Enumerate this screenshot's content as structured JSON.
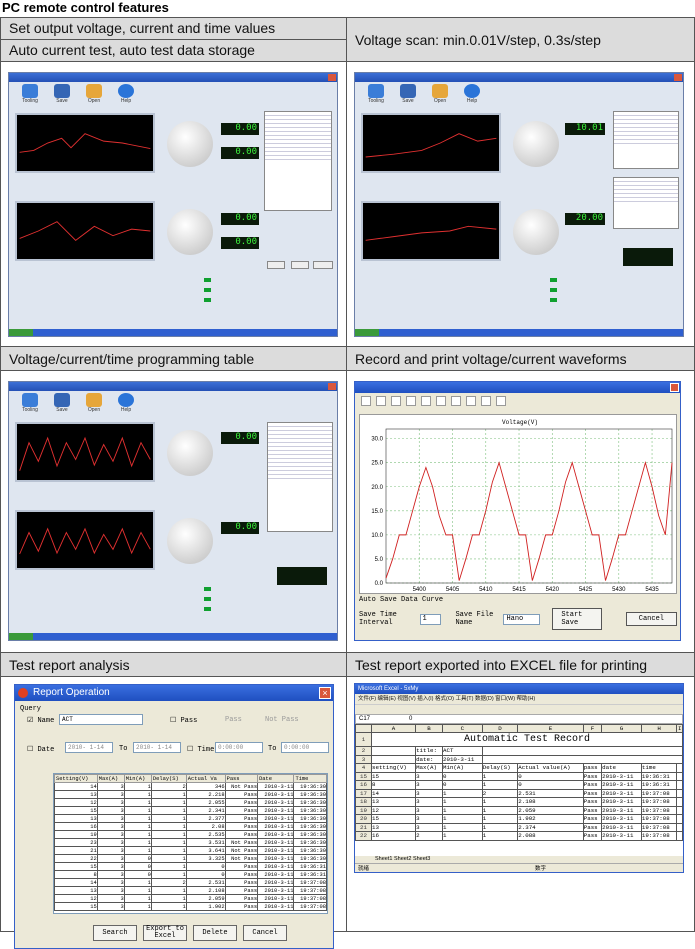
{
  "page_title": "PC remote control features",
  "cells": {
    "c1_line1": "Set output voltage, current and time values",
    "c1_line2": "Auto current test, auto test data storage",
    "c2": "Voltage scan: min.0.01V/step, 0.3s/step",
    "c3": "Voltage/current/time programming table",
    "c4": "Record and print voltage/current waveforms",
    "c5": "Test report analysis",
    "c6": "Test report exported into EXCEL file for printing"
  },
  "app_toolbar": [
    "Tooling",
    "Save",
    "Open",
    "Help"
  ],
  "lcd_values": {
    "s1_v": "0.00",
    "s1_i": "0.00",
    "s2_v": "10.01",
    "s2_i": "20.00",
    "s3_v": "0.00",
    "s3_i": "0.00"
  },
  "waveform": {
    "plot_title": "Voltage(V)",
    "auto_save_label": "Auto Save Data Curve",
    "interval_label": "Save Time Interval",
    "interval_value": "1",
    "file_name_label": "Save File Name",
    "file_name_value": "Hano",
    "start_button": "Start Save",
    "cancel_button": "Cancel"
  },
  "report": {
    "window_title": "Report Operation",
    "query_label": "Query",
    "name_label": "Name",
    "name_value": "ACT",
    "pass_label": "Pass",
    "radio_pass": "Pass",
    "radio_notpass": "Not Pass",
    "date_label": "Date",
    "date_from": "2010- 1-14",
    "to_label": "To",
    "date_to": "2010- 1-14",
    "time_label": "Time",
    "time_from": "0:00:00",
    "time_to": "0:00:00",
    "buttons": {
      "search": "Search",
      "export": "Export to Excel",
      "delete": "Delete",
      "cancel": "Cancel"
    }
  },
  "report_columns": [
    "Setting(V)",
    "Max(A)",
    "Min(A)",
    "Delay(S)",
    "Actual Va",
    "Pass",
    "Date",
    "Time"
  ],
  "report_rows": [
    [
      "14",
      "3",
      "1",
      "2",
      "346",
      "Not Pass",
      "2010-3-11",
      "19:36:30"
    ],
    [
      "13",
      "3",
      "1",
      "1",
      "2.218",
      "Pass",
      "2010-3-11",
      "19:36:30"
    ],
    [
      "12",
      "3",
      "1",
      "1",
      "2.055",
      "Pass",
      "2010-3-11",
      "19:36:30"
    ],
    [
      "15",
      "3",
      "1",
      "1",
      "2.341",
      "Pass",
      "2010-3-11",
      "19:36:30"
    ],
    [
      "13",
      "3",
      "1",
      "1",
      "2.377",
      "Pass",
      "2010-3-11",
      "19:36:30"
    ],
    [
      "16",
      "3",
      "1",
      "1",
      "2.08",
      "Pass",
      "2010-3-11",
      "19:36:30"
    ],
    [
      "19",
      "3",
      "1",
      "1",
      "2.535",
      "Pass",
      "2010-3-11",
      "19:36:30"
    ],
    [
      "23",
      "3",
      "1",
      "1",
      "3.531",
      "Not Pass",
      "2010-3-11",
      "19:36:30"
    ],
    [
      "21",
      "3",
      "1",
      "1",
      "3.641",
      "Not Pass",
      "2010-3-11",
      "19:36:30"
    ],
    [
      "22",
      "3",
      "0",
      "1",
      "3.325",
      "Not Pass",
      "2010-3-11",
      "19:36:30"
    ],
    [
      "15",
      "3",
      "0",
      "1",
      "0",
      "Pass",
      "2010-3-11",
      "19:36:31"
    ],
    [
      "8",
      "3",
      "0",
      "1",
      "0",
      "Pass",
      "2010-3-11",
      "19:36:31"
    ],
    [
      "14",
      "3",
      "1",
      "2",
      "2.531",
      "Pass",
      "2010-3-11",
      "19:37:08"
    ],
    [
      "13",
      "3",
      "1",
      "1",
      "2.108",
      "Pass",
      "2010-3-11",
      "19:37:08"
    ],
    [
      "12",
      "3",
      "1",
      "1",
      "2.059",
      "Pass",
      "2010-3-11",
      "19:37:08"
    ],
    [
      "15",
      "3",
      "1",
      "1",
      "1.902",
      "Pass",
      "2010-3-11",
      "19:37:08"
    ]
  ],
  "excel": {
    "window_title": "Microsoft Excel - 5xMy",
    "menu": [
      "文件(F)",
      "编辑(E)",
      "视图(V)",
      "插入(I)",
      "格式(O)",
      "工具(T)",
      "数据(D)",
      "窗口(W)",
      "帮助(H)"
    ],
    "name_box": "C17",
    "formula_value": "0",
    "sheet_title": "Automatic Test Record",
    "title_label": "title:",
    "title_value": "ACT",
    "date_label": "date:",
    "date_value": "2010-3-11",
    "col_letters": [
      "A",
      "B",
      "C",
      "D",
      "E",
      "F",
      "G",
      "H",
      "I"
    ],
    "headers": [
      "setting(V)",
      "Max(A)",
      "Min(A)",
      "Delay(S)",
      "Actual value(A)",
      "pass",
      "date",
      "time"
    ],
    "rows": [
      [
        "15",
        "15",
        "3",
        "0",
        "1",
        "0",
        "Pass",
        "2010-3-11",
        "19:36:31"
      ],
      [
        "16",
        "8",
        "3",
        "0",
        "1",
        "0",
        "Pass",
        "2010-3-11",
        "19:36:31"
      ],
      [
        "17",
        "14",
        "3",
        "1",
        "2",
        "2.531",
        "Pass",
        "2010-3-11",
        "19:37:08"
      ],
      [
        "18",
        "13",
        "3",
        "1",
        "1",
        "2.108",
        "Pass",
        "2010-3-11",
        "19:37:08"
      ],
      [
        "19",
        "12",
        "3",
        "1",
        "1",
        "2.059",
        "Pass",
        "2010-3-11",
        "19:37:08"
      ],
      [
        "20",
        "15",
        "3",
        "1",
        "1",
        "1.902",
        "Pass",
        "2010-3-11",
        "19:37:08"
      ],
      [
        "21",
        "13",
        "3",
        "1",
        "1",
        "2.374",
        "Pass",
        "2010-3-11",
        "19:37:08"
      ],
      [
        "22",
        "16",
        "2",
        "1",
        "1",
        "2.088",
        "Pass",
        "2010-3-11",
        "19:37:08"
      ]
    ],
    "sheets": [
      "Sheet1",
      "Sheet2",
      "Sheet3"
    ],
    "status_left": "就绪",
    "status_right": "数字"
  },
  "chart_data": {
    "type": "line",
    "title": "Voltage(V)",
    "xlim": [
      5395,
      5438
    ],
    "ylim": [
      0,
      32
    ],
    "x_ticks": [
      5400,
      5405,
      5410,
      5415,
      5420,
      5425,
      5430,
      5435
    ],
    "y_ticks": [
      0,
      5,
      10,
      15,
      20,
      25,
      30
    ],
    "series": [
      {
        "color": "#d02020",
        "x": [
          5395,
          5396,
          5397,
          5398,
          5399,
          5400,
          5401,
          5402,
          5403,
          5404,
          5405,
          5406,
          5407,
          5408,
          5409,
          5410,
          5411,
          5412,
          5413,
          5414,
          5415,
          5416,
          5417,
          5418,
          5419,
          5420,
          5421,
          5422,
          5423,
          5424,
          5425,
          5426,
          5427,
          5428,
          5429,
          5430,
          5431,
          5432,
          5433,
          5434,
          5435,
          5436,
          5437,
          5438
        ],
        "y": [
          1,
          5,
          10,
          10,
          15,
          20,
          24,
          20,
          14,
          10,
          10,
          0.5,
          5,
          10,
          10,
          15,
          21,
          25,
          20,
          15,
          10,
          10,
          0.5,
          5,
          10,
          10,
          15,
          21,
          25,
          20,
          15,
          10,
          10,
          0.5,
          5,
          10,
          10,
          15,
          20,
          25,
          20,
          14,
          10,
          25
        ]
      }
    ]
  }
}
